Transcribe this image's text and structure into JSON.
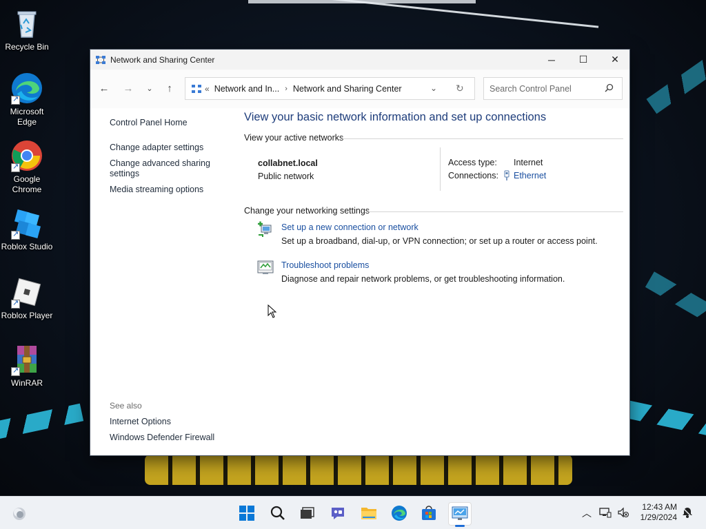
{
  "desktop": {
    "icons": [
      {
        "label": "Recycle Bin",
        "icon": "recycle-bin-icon"
      },
      {
        "label": "Microsoft Edge",
        "icon": "edge-icon"
      },
      {
        "label": "Google Chrome",
        "icon": "chrome-icon"
      },
      {
        "label": "Roblox Studio",
        "icon": "roblox-studio-icon"
      },
      {
        "label": "Roblox Player",
        "icon": "roblox-player-icon"
      },
      {
        "label": "WinRAR",
        "icon": "winrar-icon"
      }
    ]
  },
  "window": {
    "title": "Network and Sharing Center",
    "controls": {
      "minimize": "─",
      "maximize": "☐",
      "close": "✕"
    }
  },
  "address": {
    "overflow": "«",
    "crumbs": [
      "Network and In...",
      "Network and Sharing Center"
    ],
    "separator": "›"
  },
  "search": {
    "placeholder": "Search Control Panel"
  },
  "left_pane": {
    "home": "Control Panel Home",
    "links": [
      "Change adapter settings",
      "Change advanced sharing settings",
      "Media streaming options"
    ],
    "see_also_label": "See also",
    "see_also": [
      "Internet Options",
      "Windows Defender Firewall"
    ]
  },
  "main": {
    "heading": "View your basic network information and set up connections",
    "active_networks_label": "View your active networks",
    "network": {
      "name": "collabnet.local",
      "category": "Public network",
      "access_type_label": "Access type:",
      "access_type_value": "Internet",
      "connections_label": "Connections:",
      "connections_value": "Ethernet"
    },
    "change_settings_label": "Change your networking settings",
    "tasks": [
      {
        "link": "Set up a new connection or network",
        "desc": "Set up a broadband, dial-up, or VPN connection; or set up a router or access point.",
        "icon": "new-connection-icon"
      },
      {
        "link": "Troubleshoot problems",
        "desc": "Diagnose and repair network problems, or get troubleshooting information.",
        "icon": "troubleshoot-icon"
      }
    ]
  },
  "taskbar": {
    "clock_time": "12:43 AM",
    "clock_date": "1/29/2024",
    "apps": [
      "start-icon",
      "search-icon",
      "task-view-icon",
      "chat-icon",
      "file-explorer-icon",
      "edge-icon",
      "store-icon",
      "control-panel-icon"
    ]
  },
  "colors": {
    "link": "#1a4fa0",
    "heading": "#1e3d7b",
    "accent": "#1d6cd6"
  }
}
